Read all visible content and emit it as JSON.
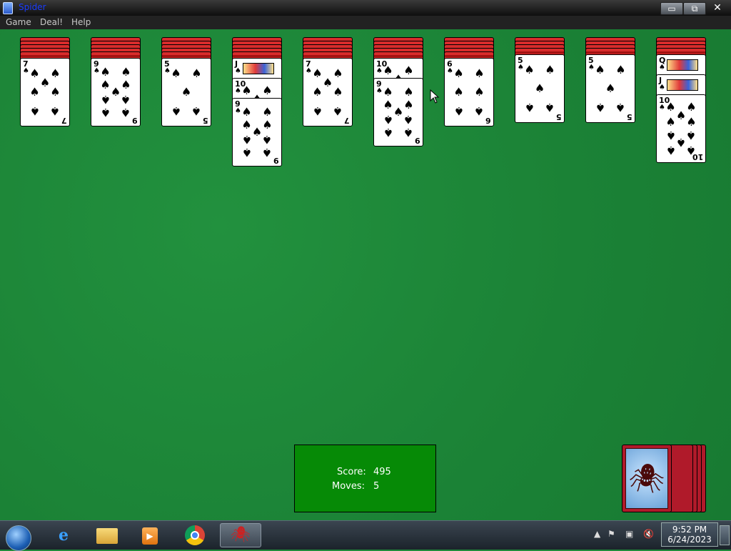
{
  "window": {
    "title": "Spider",
    "min_label": "▭",
    "max_label": "⧉",
    "close_label": "✕"
  },
  "menu": {
    "game": "Game",
    "deal": "Deal!",
    "help": "Help"
  },
  "score_panel": {
    "score_label": "Score:",
    "score_value": "495",
    "moves_label": "Moves:",
    "moves_value": "5"
  },
  "colors": {
    "felt": "#1f8a3a",
    "score_bg": "#068a06",
    "card_back": "#d82c2c"
  },
  "tableau": [
    {
      "face_up": [
        {
          "rank": "7",
          "suit": "♠"
        }
      ]
    },
    {
      "face_up": [
        {
          "rank": "9",
          "suit": "♠"
        }
      ]
    },
    {
      "face_up": [
        {
          "rank": "5",
          "suit": "♠"
        }
      ]
    },
    {
      "face_up": [
        {
          "rank": "J",
          "suit": "♠"
        },
        {
          "rank": "10",
          "suit": "♠"
        },
        {
          "rank": "9",
          "suit": "♠"
        }
      ]
    },
    {
      "face_up": [
        {
          "rank": "7",
          "suit": "♠"
        }
      ]
    },
    {
      "face_up": [
        {
          "rank": "10",
          "suit": "♠"
        },
        {
          "rank": "9",
          "suit": "♠"
        }
      ]
    },
    {
      "face_up": [
        {
          "rank": "6",
          "suit": "♠"
        }
      ]
    },
    {
      "face_up": [
        {
          "rank": "5",
          "suit": "♠"
        }
      ]
    },
    {
      "face_up": [
        {
          "rank": "5",
          "suit": "♠"
        }
      ]
    },
    {
      "face_up": [
        {
          "rank": "Q",
          "suit": "♠"
        },
        {
          "rank": "J",
          "suit": "♠"
        },
        {
          "rank": "10",
          "suit": "♠"
        }
      ]
    }
  ],
  "taskbar": {
    "icons": [
      "windows-start-icon",
      "internet-explorer-icon",
      "file-explorer-icon",
      "media-player-icon",
      "chrome-icon",
      "spider-solitaire-icon"
    ]
  },
  "clock": {
    "time": "9:52 PM",
    "date": "6/24/2023"
  }
}
